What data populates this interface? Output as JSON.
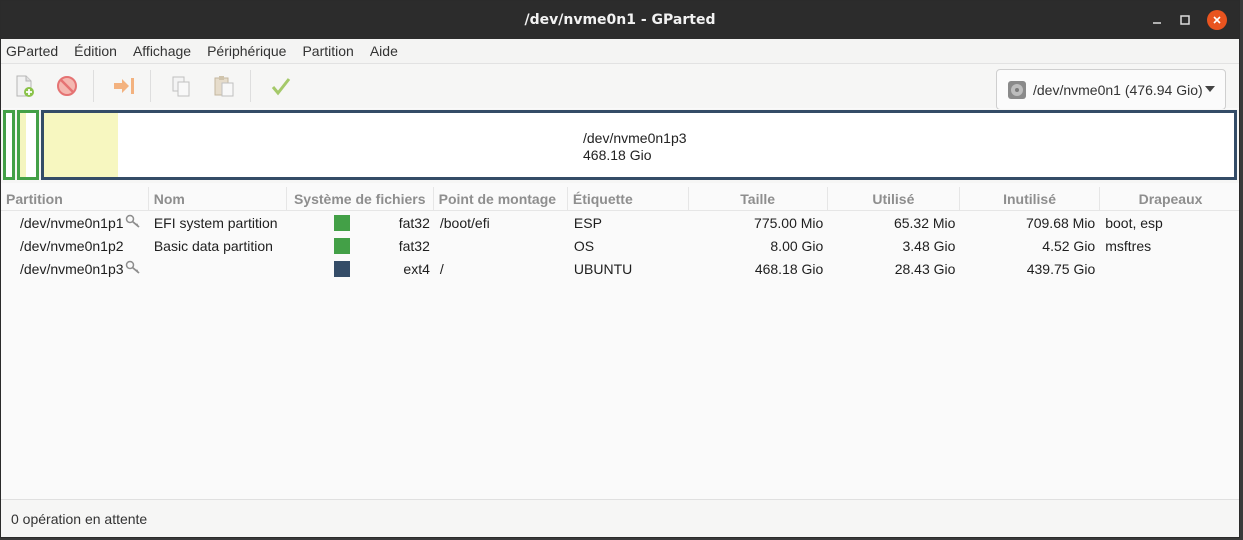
{
  "window": {
    "title": "/dev/nvme0n1 - GParted"
  },
  "menu": [
    "GParted",
    "Édition",
    "Affichage",
    "Périphérique",
    "Partition",
    "Aide"
  ],
  "toolbar": {
    "buttons": [
      "new-partition-icon",
      "delete-icon",
      "resize-move-icon",
      "copy-icon",
      "paste-icon",
      "apply-icon"
    ],
    "device": "/dev/nvme0n1 (476.94 Gio)"
  },
  "diskmap": {
    "selected_name": "/dev/nvme0n1p3",
    "selected_size": "468.18 Gio",
    "colors": {
      "fat32": "#43a047",
      "ext4": "#344c67",
      "used": "#f7f7c0"
    }
  },
  "table": {
    "headers": [
      "Partition",
      "Nom",
      "Système de fichiers",
      "Point de montage",
      "Étiquette",
      "Taille",
      "Utilisé",
      "Inutilisé",
      "Drapeaux"
    ],
    "rows": [
      {
        "partition": "/dev/nvme0n1p1",
        "key": true,
        "name": "EFI system partition",
        "fs": "fat32",
        "fs_color": "#43a047",
        "mount": "/boot/efi",
        "label": "ESP",
        "size": "775.00 Mio",
        "used": "65.32 Mio",
        "unused": "709.68 Mio",
        "flags": "boot, esp"
      },
      {
        "partition": "/dev/nvme0n1p2",
        "key": false,
        "name": "Basic data partition",
        "fs": "fat32",
        "fs_color": "#43a047",
        "mount": "",
        "label": "OS",
        "size": "8.00 Gio",
        "used": "3.48 Gio",
        "unused": "4.52 Gio",
        "flags": "msftres"
      },
      {
        "partition": "/dev/nvme0n1p3",
        "key": true,
        "name": "",
        "fs": "ext4",
        "fs_color": "#344c67",
        "mount": "/",
        "label": "UBUNTU",
        "size": "468.18 Gio",
        "used": "28.43 Gio",
        "unused": "439.75 Gio",
        "flags": ""
      }
    ]
  },
  "status": {
    "text": "0 opération en attente"
  }
}
